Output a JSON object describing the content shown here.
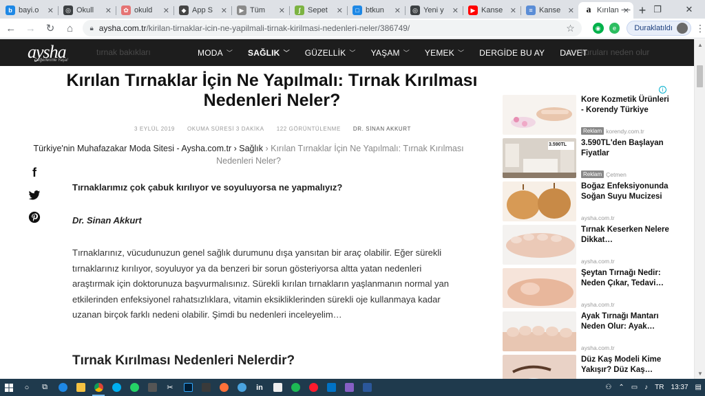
{
  "browser": {
    "tabs": [
      {
        "label": "bayi.o",
        "color": "#1e88e5",
        "glyph": "b"
      },
      {
        "label": "Okull",
        "color": "#3c4043",
        "glyph": "◎"
      },
      {
        "label": "okuld",
        "color": "#e57373",
        "glyph": "✿"
      },
      {
        "label": "App S",
        "color": "#444",
        "glyph": "◆"
      },
      {
        "label": "Tüm",
        "color": "#8a8a8a",
        "glyph": "▶"
      },
      {
        "label": "Sepet",
        "color": "#7cb342",
        "glyph": "ʃ"
      },
      {
        "label": "btkun",
        "color": "#1e88e5",
        "glyph": "□"
      },
      {
        "label": "Yeni y",
        "color": "#3c4043",
        "glyph": "◎"
      },
      {
        "label": "Kanse",
        "color": "#ff0000",
        "glyph": "▶"
      },
      {
        "label": "Kanse",
        "color": "#5b8dd6",
        "glyph": "≡"
      }
    ],
    "active_tab": {
      "label": "Kırılan",
      "glyph": "a"
    },
    "new_tab": "+",
    "url_host": "aysha.com.tr",
    "url_path": "/kirilan-tirnaklar-icin-ne-yapilmali-tirnak-kirilmasi-nedenleri-neler/386749/",
    "paused_label": "Duraklatıldı"
  },
  "site": {
    "logo": "aysha",
    "logo_tagline": "Değerlerinle Yaşa!",
    "nav_ghost_left": "tırnak bakıkları",
    "nav_ghost_right": "nan kuruları neden olur",
    "nav": [
      {
        "label": "MODA",
        "chev": true
      },
      {
        "label": "SAĞLIK",
        "chev": true,
        "active": true
      },
      {
        "label": "GÜZELLİK",
        "chev": true
      },
      {
        "label": "YAŞAM",
        "chev": true
      },
      {
        "label": "YEMEK",
        "chev": true
      },
      {
        "label": "DERGİDE BU AY",
        "chev": false
      },
      {
        "label": "DAVET",
        "chev": false
      }
    ]
  },
  "article": {
    "title": "Kırılan Tırnaklar İçin Ne Yapılmalı: Tırnak Kırılması Nedenleri Neler?",
    "date": "3 EYLÜL 2019",
    "read_time": "OKUMA SÜRESİ 3 DAKİKA",
    "views": "122 GÖRÜNTÜLENME",
    "author_meta": "DR. SİNAN AKKURT",
    "breadcrumb": {
      "home": "Türkiye'nin Muhafazakar Moda Sitesi - Aysha.com.tr",
      "sep": " › ",
      "category": "Sağlık",
      "current": "Kırılan Tırnaklar İçin Ne Yapılmalı: Tırnak Kırılması Nedenleri Neler?"
    },
    "lead": "Tırnaklarımız çok çabuk kırılıyor ve soyuluyorsa ne yapmalıyız?",
    "author": "Dr. Sinan Akkurt",
    "paragraph": "Tırnaklarınız, vücudunuzun genel sağlık durumunu dışa yansıtan bir araç olabilir. Eğer sürekli tırnaklarınız kırılıyor, soyuluyor ya da benzeri bir sorun gösteriyorsa altta yatan nedenleri araştırmak için doktorunuza başvurmalısınız.  Sürekli kırılan tırnakların yaşlanmanın normal yan etkilerinden enfeksiyonel rahatsızlıklara, vitamin eksikliklerinden sürekli oje kullanmaya kadar uzanan birçok farklı nedeni olabilir.  Şimdi bu nedenleri inceleyelim…",
    "subheading": "Tırnak Kırılması Nedenleri Nelerdir?"
  },
  "sidebar": {
    "cards": [
      {
        "title": "Kore Kozmetik Ürünleri - Korendy Türkiye",
        "badge": "Reklam",
        "source": "korendy.com.tr",
        "theme": "spa"
      },
      {
        "title": "3.590TL'den Başlayan Fiyatlar",
        "badge": "Reklam",
        "source": "Çetmen",
        "theme": "room",
        "overlay": "3.590TL"
      },
      {
        "title": "Boğaz Enfeksiyonunda Soğan Suyu Mucizesi",
        "badge": "",
        "source": "aysha.com.tr",
        "theme": "onion"
      },
      {
        "title": "Tırnak Keserken Nelere Dikkat…",
        "badge": "",
        "source": "aysha.com.tr",
        "theme": "feet"
      },
      {
        "title": "Şeytan Tırnağı Nedir: Neden Çıkar, Tedavi…",
        "badge": "",
        "source": "aysha.com.tr",
        "theme": "finger"
      },
      {
        "title": "Ayak Tırnağı Mantarı Neden Olur: Ayak…",
        "badge": "",
        "source": "aysha.com.tr",
        "theme": "toes"
      },
      {
        "title": "Düz Kaş Modeli Kime Yakışır? Düz Kaş…",
        "badge": "",
        "source": "",
        "theme": "brow"
      }
    ]
  },
  "taskbar": {
    "time": "13:37",
    "lang": "TR"
  }
}
